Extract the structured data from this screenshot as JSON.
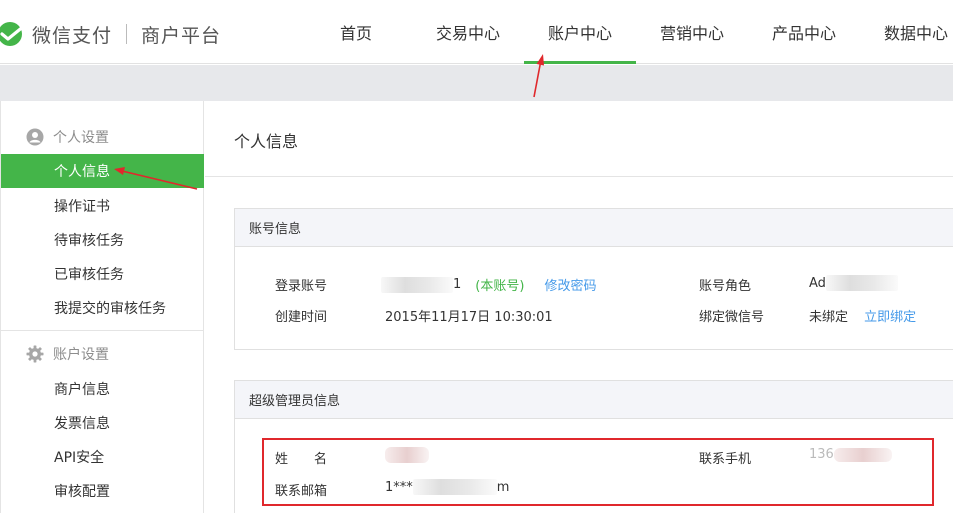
{
  "header": {
    "brand": "微信支付",
    "subtitle": "商户平台",
    "logo_icon": "wechat-pay-check-icon",
    "brand_color": "#44b549",
    "nav": [
      {
        "label": "首页",
        "active": false
      },
      {
        "label": "交易中心",
        "active": false
      },
      {
        "label": "账户中心",
        "active": true
      },
      {
        "label": "营销中心",
        "active": false
      },
      {
        "label": "产品中心",
        "active": false
      },
      {
        "label": "数据中心",
        "active": false
      }
    ]
  },
  "sidebar": {
    "group_personal": {
      "label": "个人设置",
      "icon": "user-circle-icon"
    },
    "personal_items": [
      {
        "label": "个人信息",
        "active": true
      },
      {
        "label": "操作证书",
        "active": false
      },
      {
        "label": "待审核任务",
        "active": false
      },
      {
        "label": "已审核任务",
        "active": false
      },
      {
        "label": "我提交的审核任务",
        "active": false
      }
    ],
    "group_account": {
      "label": "账户设置",
      "icon": "gear-icon"
    },
    "account_items": [
      {
        "label": "商户信息",
        "active": false
      },
      {
        "label": "发票信息",
        "active": false
      },
      {
        "label": "API安全",
        "active": false
      },
      {
        "label": "审核配置",
        "active": false
      }
    ]
  },
  "main": {
    "title": "个人信息",
    "account_card": {
      "heading": "账号信息",
      "login_label": "登录账号",
      "login_value_tail": "1",
      "login_note": "(本账号)",
      "change_pw": "修改密码",
      "role_label": "账号角色",
      "role_value_head": "Ad",
      "created_label": "创建时间",
      "created_value": "2015年11月17日 10:30:01",
      "wechat_label": "绑定微信号",
      "wechat_value": "未绑定",
      "bind_now": "立即绑定"
    },
    "admin_card": {
      "heading": "超级管理员信息",
      "name_label": "姓　　名",
      "phone_label": "联系手机",
      "phone_value_head": "136",
      "email_label": "联系邮箱",
      "email_value_head": "1***",
      "email_value_tail": "m"
    }
  },
  "colors": {
    "accent": "#44b549",
    "link": "#459ae9",
    "annotation": "#e0282c"
  }
}
